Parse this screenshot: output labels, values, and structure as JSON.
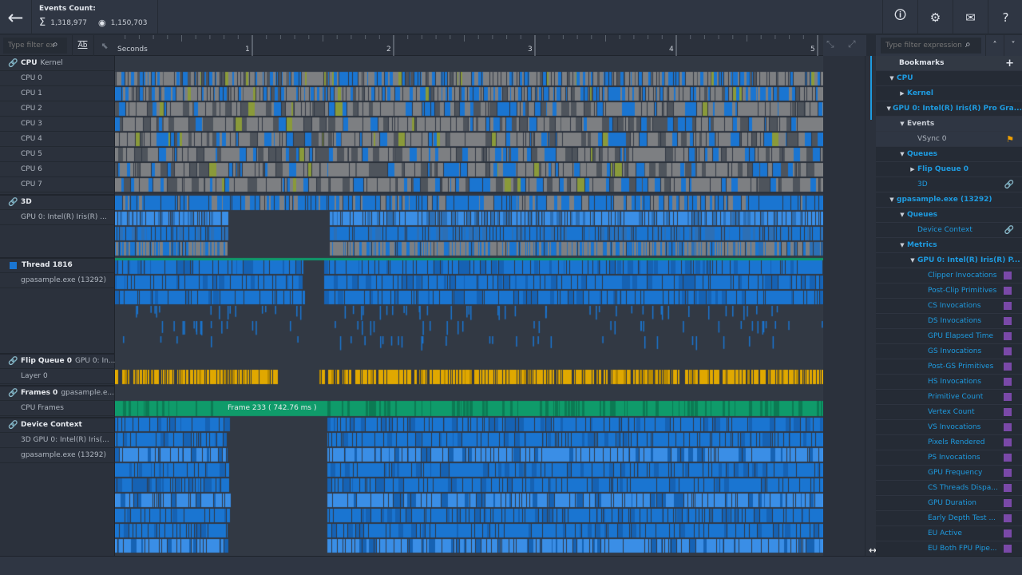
{
  "header": {
    "back": "←",
    "events_title": "Events Count:",
    "total_icon": "Σ",
    "total": "1,318,977",
    "visible_icon": "eye-icon",
    "visible": "1,150,703"
  },
  "toolbar_icons": [
    {
      "name": "feedback-icon",
      "glyph": "🛈"
    },
    {
      "name": "gear-icon",
      "glyph": "⚙"
    },
    {
      "name": "mail-icon",
      "glyph": "✉"
    },
    {
      "name": "help-icon",
      "glyph": "?"
    }
  ],
  "left_filter": {
    "placeholder": "Type filter ex",
    "ab_label": "Ab"
  },
  "ruler": {
    "unit": "Seconds",
    "ticks": [
      "1",
      "2",
      "3",
      "4",
      "5"
    ]
  },
  "tracks": {
    "cpu": {
      "title": "CPU",
      "sub": "Kernel",
      "rows": [
        "CPU 0",
        "CPU 1",
        "CPU 2",
        "CPU 3",
        "CPU 4",
        "CPU 5",
        "CPU 6",
        "CPU 7"
      ]
    },
    "gpu3d": {
      "title": "3D",
      "rows": [
        "GPU 0: Intel(R) Iris(R) ..."
      ]
    },
    "thread": {
      "title": "Thread 1816",
      "rows": [
        "gpasample.exe (13292)"
      ]
    },
    "flip": {
      "title": "Flip Queue 0",
      "sub": "GPU 0: In...",
      "rows": [
        "Layer 0"
      ]
    },
    "frames": {
      "title": "Frames 0",
      "sub": "gpasample.e...",
      "rows": [
        "CPU Frames"
      ],
      "tooltip": "Frame 233 ( 742.76 ms )"
    },
    "device": {
      "title": "Device Context",
      "rows": [
        "3D GPU 0: Intel(R) Iris(...",
        "gpasample.exe (13292)"
      ]
    }
  },
  "colors": {
    "blue": "#1a75d1",
    "gray": "#7d7f82",
    "orange": "#e0a800",
    "green": "#0f9b6a",
    "accent": "#1e9be0",
    "metric": "#7a49a8",
    "flag": "#f0a000"
  },
  "right_panel": {
    "filter_placeholder": "Type filter expression",
    "bookmarks_title": "Bookmarks",
    "add": "+",
    "items": [
      {
        "label": "CPU",
        "level": 0,
        "arrow": "▼"
      },
      {
        "label": "Kernel",
        "level": 1,
        "arrow": "▶"
      },
      {
        "label": "GPU 0: Intel(R) Iris(R) Pro Gra...",
        "level": 0,
        "arrow": "▼"
      },
      {
        "label": "Events",
        "level": 1,
        "arrow": "▼",
        "muted": true
      },
      {
        "label": "VSync 0",
        "level": 2,
        "leaf": true,
        "muted": true,
        "flag": true
      },
      {
        "label": "Queues",
        "level": 1,
        "arrow": "▼"
      },
      {
        "label": "Flip Queue 0",
        "level": 2,
        "arrow": "▶"
      },
      {
        "label": "3D",
        "level": 2,
        "leaf": true,
        "link": true
      },
      {
        "label": "gpasample.exe (13292)",
        "level": 0,
        "arrow": "▼"
      },
      {
        "label": "Queues",
        "level": 1,
        "arrow": "▼"
      },
      {
        "label": "Device Context",
        "level": 2,
        "leaf": true,
        "link": true
      },
      {
        "label": "Metrics",
        "level": 1,
        "arrow": "▼"
      },
      {
        "label": "GPU 0: Intel(R) Iris(R) P...",
        "level": 2,
        "arrow": "▼"
      },
      {
        "label": "Clipper Invocations",
        "level": 3,
        "metric": true
      },
      {
        "label": "Post-Clip Primitives",
        "level": 3,
        "metric": true
      },
      {
        "label": "CS Invocations",
        "level": 3,
        "metric": true
      },
      {
        "label": "DS Invocations",
        "level": 3,
        "metric": true
      },
      {
        "label": "GPU Elapsed Time",
        "level": 3,
        "metric": true
      },
      {
        "label": "GS Invocations",
        "level": 3,
        "metric": true
      },
      {
        "label": "Post-GS Primitives",
        "level": 3,
        "metric": true
      },
      {
        "label": "HS Invocations",
        "level": 3,
        "metric": true
      },
      {
        "label": "Primitive Count",
        "level": 3,
        "metric": true
      },
      {
        "label": "Vertex Count",
        "level": 3,
        "metric": true
      },
      {
        "label": "VS Invocations",
        "level": 3,
        "metric": true
      },
      {
        "label": "Pixels Rendered",
        "level": 3,
        "metric": true
      },
      {
        "label": "PS Invocations",
        "level": 3,
        "metric": true
      },
      {
        "label": "GPU Frequency",
        "level": 3,
        "metric": true
      },
      {
        "label": "CS Threads Dispa...",
        "level": 3,
        "metric": true
      },
      {
        "label": "GPU Duration",
        "level": 3,
        "metric": true
      },
      {
        "label": "Early Depth Test ...",
        "level": 3,
        "metric": true
      },
      {
        "label": "EU Active",
        "level": 3,
        "metric": true
      },
      {
        "label": "EU Both FPU Pipe...",
        "level": 3,
        "metric": true
      }
    ]
  }
}
